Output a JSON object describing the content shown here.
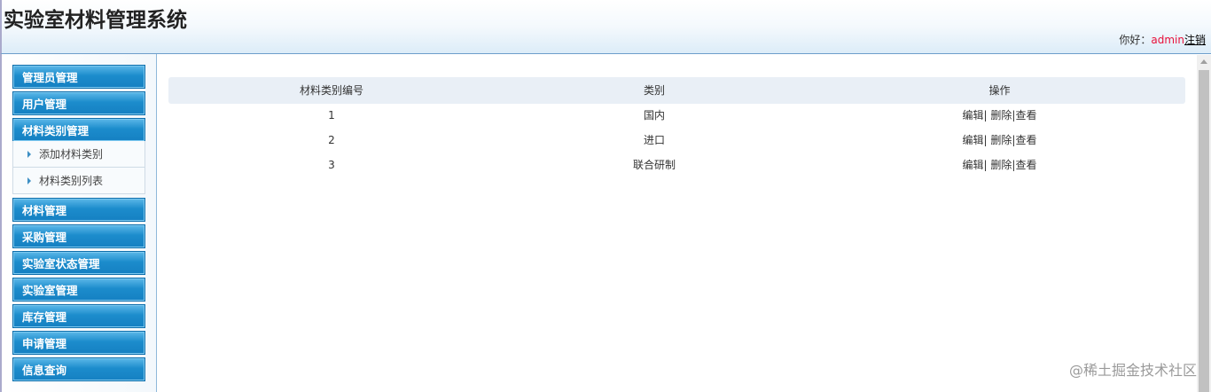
{
  "header": {
    "title": "实验室材料管理系统",
    "greeting": "你好：",
    "username": "admin",
    "logout": "注销"
  },
  "sidebar": {
    "menus": [
      {
        "label": "管理员管理"
      },
      {
        "label": "用户管理"
      },
      {
        "label": "材料类别管理",
        "sub": [
          {
            "label": "添加材料类别"
          },
          {
            "label": "材料类别列表"
          }
        ]
      },
      {
        "label": "材料管理"
      },
      {
        "label": "采购管理"
      },
      {
        "label": "实验室状态管理"
      },
      {
        "label": "实验室管理"
      },
      {
        "label": "库存管理"
      },
      {
        "label": "申请管理"
      },
      {
        "label": "信息查询"
      }
    ]
  },
  "table": {
    "columns": [
      "材料类别编号",
      "类别",
      "操作"
    ],
    "rows": [
      {
        "id": "1",
        "category": "国内"
      },
      {
        "id": "2",
        "category": "进口"
      },
      {
        "id": "3",
        "category": "联合研制"
      }
    ],
    "actions": {
      "edit": "编辑",
      "delete": "删除",
      "view": "查看",
      "sep": "|"
    }
  },
  "watermark": "@稀土掘金技术社区"
}
